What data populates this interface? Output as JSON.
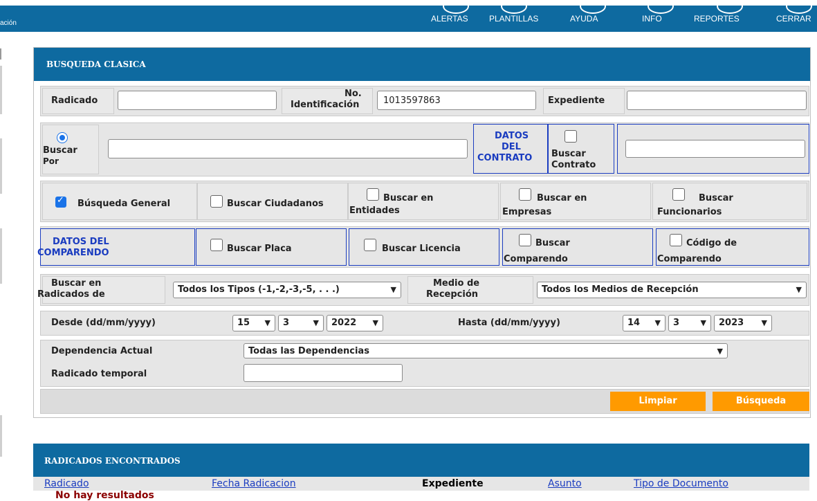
{
  "topbar": {
    "left_text": "ación",
    "nav": [
      "ALERTAS",
      "PLANTILLAS",
      "AYUDA",
      "INFO",
      "REPORTES",
      "CERRAR"
    ]
  },
  "search_panel": {
    "title": "BUSQUEDA CLASICA",
    "radicado_label": "Radicado",
    "radicado_value": "",
    "no_ident_label_1": "No.",
    "no_ident_label_2": "Identificación",
    "no_ident_value": "1013597863",
    "expediente_label": "Expediente",
    "expediente_value": "",
    "buscar_por_label_1": "Buscar",
    "buscar_por_label_2": "Por",
    "buscar_por_value": "",
    "datos_contrato_1": "DATOS",
    "datos_contrato_2": "DEL",
    "datos_contrato_3": "CONTRATO",
    "buscar_contrato_1": "Buscar",
    "buscar_contrato_2": "Contrato",
    "contrato_value": "",
    "busqueda_general": "Búsqueda General",
    "buscar_ciudadanos": "Buscar Ciudadanos",
    "buscar_entidades_1": "Buscar en",
    "buscar_entidades_2": "Entidades",
    "buscar_empresas_1": "Buscar en",
    "buscar_empresas_2": "Empresas",
    "buscar_funcionarios_1": "Buscar",
    "buscar_funcionarios_2": "Funcionarios",
    "datos_comparendo_1": "DATOS DEL",
    "datos_comparendo_2": "COMPARENDO",
    "buscar_placa": "Buscar Placa",
    "buscar_licencia": "Buscar Licencia",
    "buscar_comparendo_1": "Buscar",
    "buscar_comparendo_2": "Comparendo",
    "codigo_comparendo_1": "Código de",
    "codigo_comparendo_2": "Comparendo",
    "buscar_radicados_1": "Buscar en",
    "buscar_radicados_2": "Radicados de",
    "tipos_select": "Todos los Tipos (-1,-2,-3,-5, . . .)",
    "medio_label_1": "Medio de",
    "medio_label_2": "Recepción",
    "medios_select": "Todos los Medios de Recepción",
    "desde_label": "Desde (dd/mm/yyyy)",
    "desde_day": "15",
    "desde_month": "3",
    "desde_year": "2022",
    "hasta_label": "Hasta (dd/mm/yyyy)",
    "hasta_day": "14",
    "hasta_month": "3",
    "hasta_year": "2023",
    "dependencia_label": "Dependencia Actual",
    "dependencia_select": "Todas las Dependencias",
    "radicado_temporal_label": "Radicado temporal",
    "radicado_temporal_value": "",
    "limpiar": "Limpiar",
    "busqueda": "Búsqueda"
  },
  "results": {
    "title": "RADICADOS ENCONTRADOS",
    "columns": [
      "Radicado",
      "Fecha Radicacion",
      "Expediente",
      "Asunto",
      "Tipo de Documento"
    ],
    "no_results": "No hay resultados"
  },
  "colors": {
    "header": "#0e6aa0",
    "button": "#ff9a00",
    "link": "#1a3cc0",
    "error": "#8b0000"
  }
}
